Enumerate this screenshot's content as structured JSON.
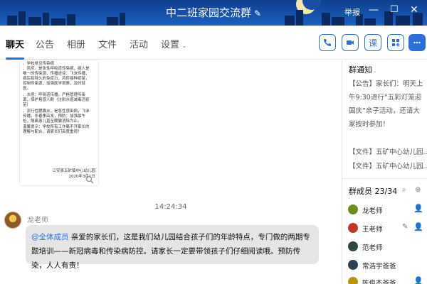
{
  "window": {
    "title": "中二班家园交流群",
    "report_label": "举报",
    "edit_glyph": "✎",
    "min_glyph": "—",
    "max_glyph": "☐",
    "close_glyph": "✕"
  },
  "tabs": [
    {
      "label": "聊天",
      "active": true
    },
    {
      "label": "公告"
    },
    {
      "label": "相册"
    },
    {
      "label": "文件"
    },
    {
      "label": "活动"
    },
    {
      "label": "设置"
    }
  ],
  "tabs_more_glyph": "⌄",
  "toolbar": {
    "call_icon": "phone-icon",
    "video_icon": "video-icon",
    "class_label": "课",
    "add_app_icon": "add-app-icon",
    "more_icon": "more-icon"
  },
  "chat": {
    "notice_image": {
      "lines": [
        "、学校常见传染病",
        "、风疹、是急性呼吸道传染病，病人是",
        "唯一的传染源，传播途径：飞沫传播，",
        "病后有持久的免疫力，风疹接种疫苗，",
        "控制传染源，加强医学观察，及时就",
        "医。",
        "、水痘：呼吸道传播，严格管理传染",
        "源，保护易感人群（注射水痘减毒活疫",
        "苗）",
        "、流行性腮腺炎，是急性感染病，飞沫",
        "传播，冬春季高发，预防：加强晨午",
        "检，隔离患儿直至腮腺消除为止。",
        "温馨提示：学校所有工作离不开家长的",
        "理解与配合，请家长们高度重视！"
      ],
      "signature": "江安县五矿镇中心幼儿园",
      "date": "2020年3月1日"
    },
    "zoom_glyph": "🔍",
    "timestamp": "14:24:34",
    "sender": "龙老师",
    "mention": "@全体成员",
    "message": " 亲爱的家长们，这是我们幼儿园结合孩子们的年龄特点，专门做的两期专题培训——新冠病毒和传染病防控。请家长一定要带领孩子们仔细阅读哦。预防传染，人人有责！"
  },
  "right_panel": {
    "notice_title": "群通知",
    "notice_text": "【公告】家长们：明天上午9:30进行“五彩灯笼迎国庆”亲子活动，还请大家按时参加！",
    "files": [
      "【文件】五矿中心幼儿园...",
      "【文件】五矿中心幼儿园..."
    ],
    "members_title": "群成员 23/34",
    "search_glyph": "⌕",
    "add_member_glyph": "⊕",
    "members": [
      {
        "name": "龙老师",
        "color": "#6b8e23",
        "role_glyph": "👤"
      },
      {
        "name": "王老师",
        "color": "#c0392b",
        "role_glyph": "👤",
        "edit": "✎"
      },
      {
        "name": "范老师",
        "color": "#2e4a3a",
        "role_glyph": ""
      },
      {
        "name": "常浩宇爸爸",
        "color": "#2c3e50",
        "role_glyph": ""
      },
      {
        "name": "陈俊杰爸爸",
        "color": "#b7950b",
        "role_glyph": "👤"
      }
    ]
  }
}
